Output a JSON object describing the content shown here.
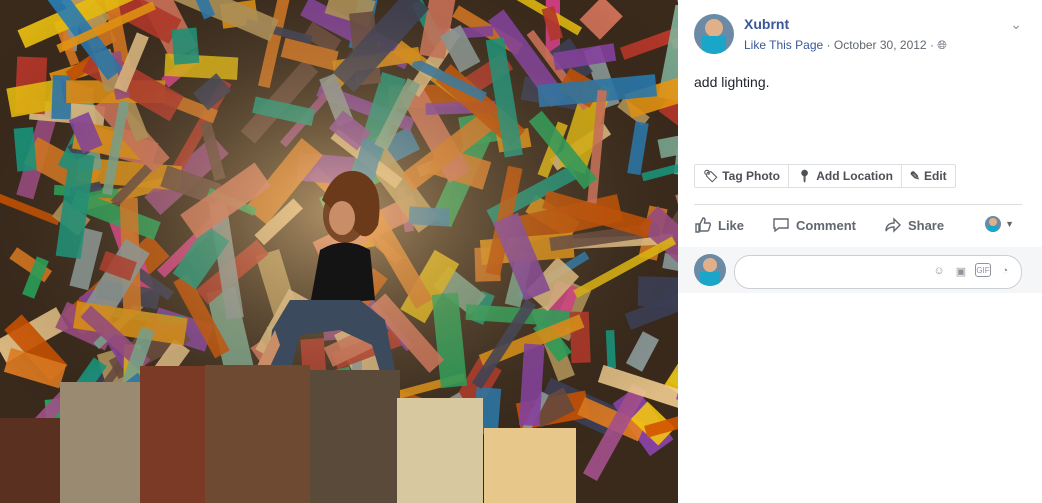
{
  "post": {
    "author": "Xubrnt",
    "page_link": "Like This Page",
    "date": "October 30, 2012",
    "dot1": "·",
    "dot2": "·",
    "caption": "add lighting."
  },
  "toolbar": {
    "tag_photo": "Tag Photo",
    "add_location": "Add Location",
    "edit": "Edit"
  },
  "actions": {
    "like": "Like",
    "comment": "Comment",
    "share": "Share"
  },
  "icons": {
    "chevron": "chevron-down-icon",
    "globe": "globe-icon",
    "tag": "tag-icon",
    "location": "location-pin-icon",
    "edit": "pencil-icon",
    "like": "thumbs-up-icon",
    "comment": "comment-bubble-icon",
    "share": "share-arrow-icon",
    "emoji": "emoji-icon",
    "camera": "camera-icon",
    "gif": "gif-icon",
    "sticker": "sticker-icon"
  },
  "colors": {
    "link": "#385898",
    "text": "#1d2129",
    "muted": "#616770"
  }
}
